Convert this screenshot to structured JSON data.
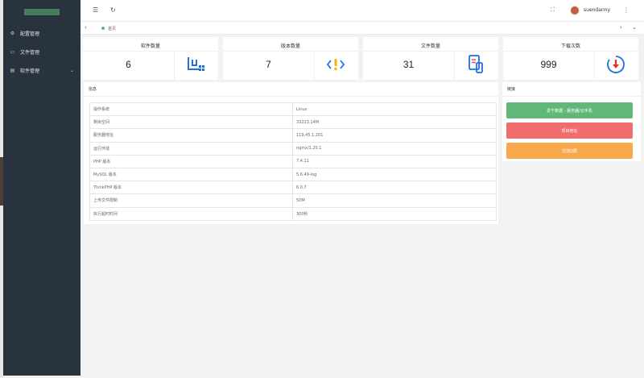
{
  "sidebar": {
    "items": [
      {
        "label": "配置管理",
        "icon": "gear-icon"
      },
      {
        "label": "文件管理",
        "icon": "file-icon"
      },
      {
        "label": "软件管理",
        "icon": "app-icon"
      }
    ]
  },
  "header": {
    "username": "suendanny",
    "icons": [
      "menu-icon",
      "refresh-icon",
      "fullscreen-icon",
      "more-icon"
    ]
  },
  "tabs": [
    {
      "label": "首页",
      "active": true
    }
  ],
  "stats": [
    {
      "title": "软件数量",
      "value": "6",
      "icon": "software-icon",
      "color": "#1e6fe8"
    },
    {
      "title": "版本数量",
      "value": "7",
      "icon": "code-warning-icon",
      "color": "#1e6fe8"
    },
    {
      "title": "文件数量",
      "value": "31",
      "icon": "document-icon",
      "color": "#1e6fe8"
    },
    {
      "title": "下载次数",
      "value": "999",
      "icon": "download-icon",
      "color": "#e03030"
    }
  ],
  "info": {
    "title": "信息",
    "rows": [
      {
        "key": "操作系统",
        "value": "Linux"
      },
      {
        "key": "剩余空间",
        "value": "33223.14M"
      },
      {
        "key": "服务器地址",
        "value": "119.45.1.201"
      },
      {
        "key": "运行环境",
        "value": "nginx/1.20.1"
      },
      {
        "key": "PHP 版本",
        "value": "7.4.11"
      },
      {
        "key": "MySQL 版本",
        "value": "5.6.49-log"
      },
      {
        "key": "ThinkPHP 版本",
        "value": "6.0.7"
      },
      {
        "key": "上传文件限制",
        "value": "50M"
      },
      {
        "key": "执行超时时间",
        "value": "300秒"
      }
    ]
  },
  "links": {
    "title": "链接",
    "buttons": [
      {
        "label": "爱千数据 - 服务器/云手机",
        "color": "#5fb878"
      },
      {
        "label": "项目地址",
        "color": "#f06d6d"
      },
      {
        "label": "交流Q群",
        "color": "#f7a94b"
      }
    ]
  }
}
